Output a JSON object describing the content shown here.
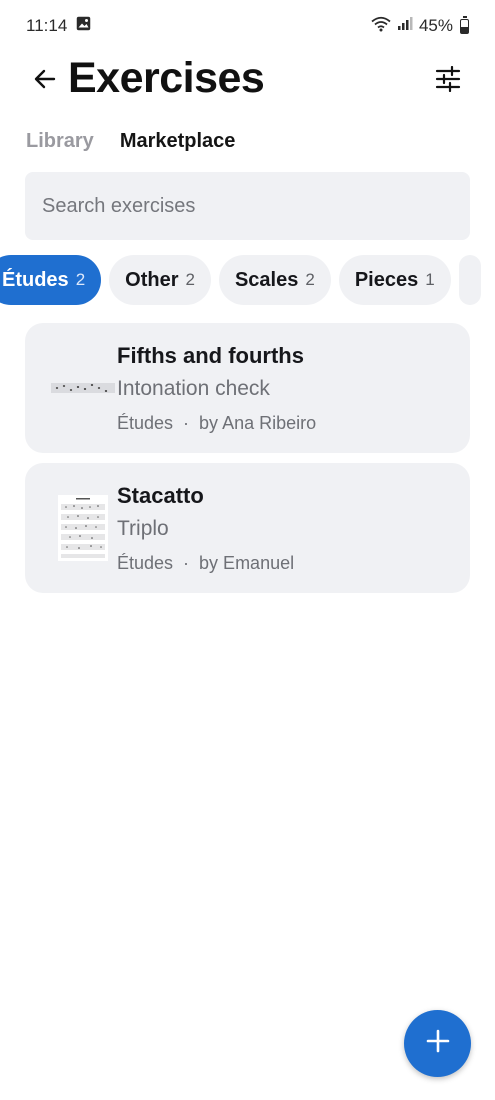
{
  "status_bar": {
    "time": "11:14",
    "battery": "45%",
    "icons": [
      "gallery-notification-icon",
      "wifi-icon",
      "signal-icon",
      "battery-icon"
    ]
  },
  "header": {
    "title": "Exercises",
    "back_icon": "arrow-left-icon",
    "filter_icon": "sliders-icon"
  },
  "tabs": [
    {
      "label": "Library",
      "active": false
    },
    {
      "label": "Marketplace",
      "active": true
    }
  ],
  "search": {
    "placeholder": "Search exercises",
    "value": ""
  },
  "chips": [
    {
      "label": "Études",
      "count": "2",
      "selected": true
    },
    {
      "label": "Other",
      "count": "2",
      "selected": false
    },
    {
      "label": "Scales",
      "count": "2",
      "selected": false
    },
    {
      "label": "Pieces",
      "count": "1",
      "selected": false
    }
  ],
  "exercises": [
    {
      "title": "Fifths and fourths",
      "subtitle": "Intonation check",
      "category": "Études",
      "separator": "·",
      "author": "by Ana Ribeiro",
      "thumbnail": "sheet-music-single-line-thumbnail"
    },
    {
      "title": "Stacatto",
      "subtitle": "Triplo",
      "category": "Études",
      "separator": "·",
      "author": "by Emanuel",
      "thumbnail": "sheet-music-page-thumbnail"
    }
  ],
  "fab": {
    "icon": "plus-icon"
  },
  "colors": {
    "accent": "#1f6fd0",
    "surface": "#f0f1f4",
    "muted_text": "#6e7076"
  }
}
